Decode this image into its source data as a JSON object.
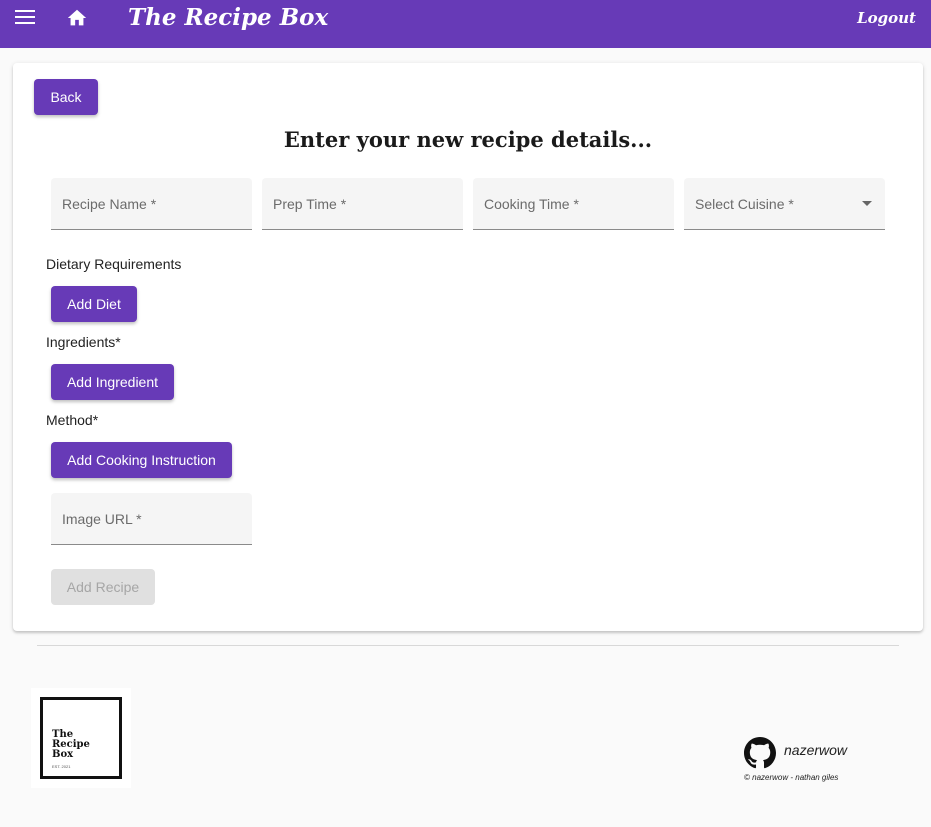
{
  "app": {
    "title": "The Recipe Box",
    "logout_label": "Logout",
    "accent_color": "#673ab7",
    "icons": {
      "menu": "menu-icon",
      "home": "home-icon"
    }
  },
  "form": {
    "back_label": "Back",
    "heading": "Enter your new recipe details...",
    "fields": {
      "recipe_name": "Recipe Name *",
      "prep_time": "Prep Time *",
      "cooking_time": "Cooking Time *",
      "cuisine": "Select Cuisine *",
      "image_url": "Image URL *"
    },
    "dietary_label": "Dietary Requirements",
    "add_diet_label": "Add Diet",
    "ingredients_label": "Ingredients*",
    "add_ingredient_label": "Add Ingredient",
    "method_label": "Method*",
    "add_instruction_label": "Add Cooking Instruction",
    "submit_label": "Add Recipe"
  },
  "footer": {
    "logo_text": "The Recipe Box",
    "logo_sub": "EST. 2021",
    "github_icon": "github-icon",
    "github_user": "nazerwow",
    "copyright": "© nazerwow - nathan giles"
  }
}
